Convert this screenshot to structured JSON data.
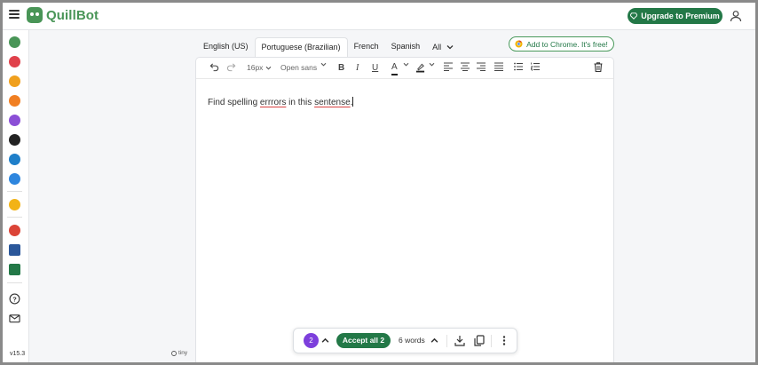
{
  "app": {
    "name": "QuillBot",
    "brand_color": "#499557",
    "accent_color": "#237847"
  },
  "header": {
    "premium_label": "Upgrade to Premium",
    "menu_icon": "hamburger-icon",
    "account_icon": "user-icon"
  },
  "sidebar": {
    "icons": [
      {
        "name": "paraphraser-icon",
        "color": "#499557"
      },
      {
        "name": "grammar-checker-icon",
        "color": "#e0414b"
      },
      {
        "name": "plagiarism-checker-icon",
        "color": "#f0a01e"
      },
      {
        "name": "ai-detector-icon",
        "color": "#f07f22"
      },
      {
        "name": "summarizer-icon",
        "color": "#8b4fd6"
      },
      {
        "name": "translator-icon",
        "color": "#222222"
      },
      {
        "name": "citation-generator-icon",
        "color": "#1f7fc9"
      },
      {
        "name": "flow-icon",
        "color": "#2e86de"
      },
      {
        "name": "premium-icon",
        "color": "#f2b316"
      },
      {
        "name": "chrome-extension-icon",
        "color": "#db4437"
      },
      {
        "name": "word-addin-icon",
        "color": "#2b579a"
      },
      {
        "name": "desktop-app-icon",
        "color": "#237847"
      },
      {
        "name": "help-icon",
        "color": "#333333"
      },
      {
        "name": "mail-icon",
        "color": "#333333"
      }
    ],
    "version": "v15.3"
  },
  "tabs": [
    {
      "label": "English (US)",
      "active": false
    },
    {
      "label": "Portuguese (Brazilian)",
      "active": true
    },
    {
      "label": "French",
      "active": false
    },
    {
      "label": "Spanish",
      "active": false
    },
    {
      "label": "All",
      "active": false
    }
  ],
  "chrome_extension": {
    "label": "Add to Chrome. It's free!"
  },
  "toolbar": {
    "font_size": "16px",
    "font_family": "Open sans",
    "bold": "B",
    "italic": "I",
    "underline": "U",
    "font_color": "A"
  },
  "editor": {
    "segments": [
      {
        "text": "Find spelling ",
        "error": false
      },
      {
        "text": "errrors",
        "error": true
      },
      {
        "text": " in this ",
        "error": false
      },
      {
        "text": "sentense",
        "error": true
      },
      {
        "text": ".",
        "error": false
      }
    ],
    "error_underline_color": "#d84040"
  },
  "tiny": {
    "label": "tiny"
  },
  "bottom_bar": {
    "issue_count": "2",
    "issue_badge_color": "#7d3fdc",
    "accept_all_label": "Accept all 2",
    "word_count": "6 words"
  }
}
